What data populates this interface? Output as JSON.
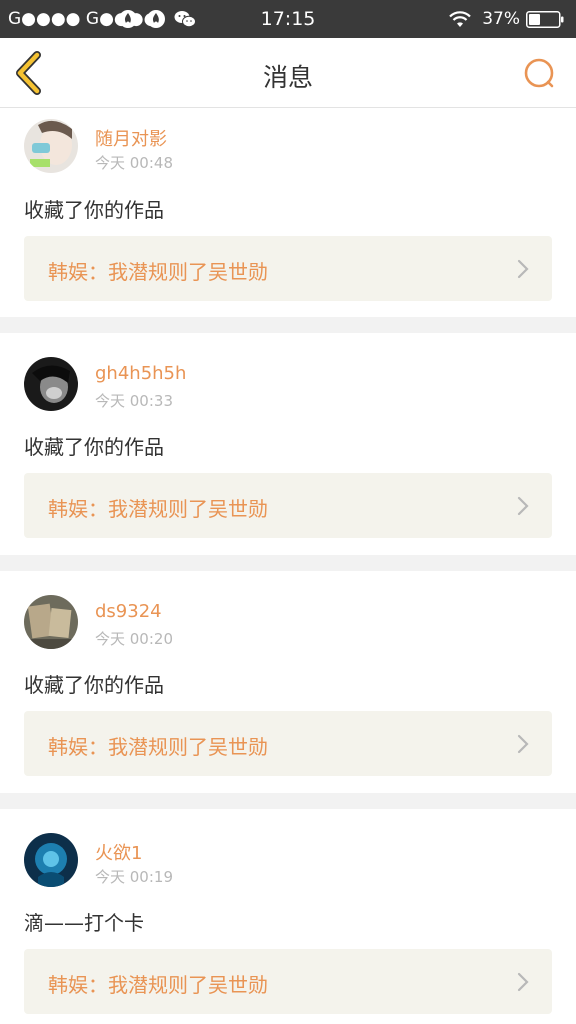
{
  "status_bar": {
    "carrier": "G●●●● G●●●●",
    "time": "17:15",
    "battery_percent": "37%"
  },
  "nav": {
    "title": "消息",
    "back_icon": "chevron-left-icon",
    "search_icon": "search-icon"
  },
  "colors": {
    "accent": "#e99454",
    "back_icon_fill": "#f5c232",
    "card_bg": "#f4f3ec"
  },
  "messages": [
    {
      "user": "随月对影",
      "time": "今天 00:48",
      "text": "收藏了你的作品",
      "work_title": "韩娱：我潜规则了吴世勋"
    },
    {
      "user": "gh4h5h5h",
      "time": "今天 00:33",
      "text": "收藏了你的作品",
      "work_title": "韩娱：我潜规则了吴世勋"
    },
    {
      "user": "ds9324",
      "time": "今天 00:20",
      "text": "收藏了你的作品",
      "work_title": "韩娱：我潜规则了吴世勋"
    },
    {
      "user": "火欲1",
      "time": "今天 00:19",
      "text": "滴——打个卡",
      "work_title": "韩娱：我潜规则了吴世勋"
    }
  ]
}
